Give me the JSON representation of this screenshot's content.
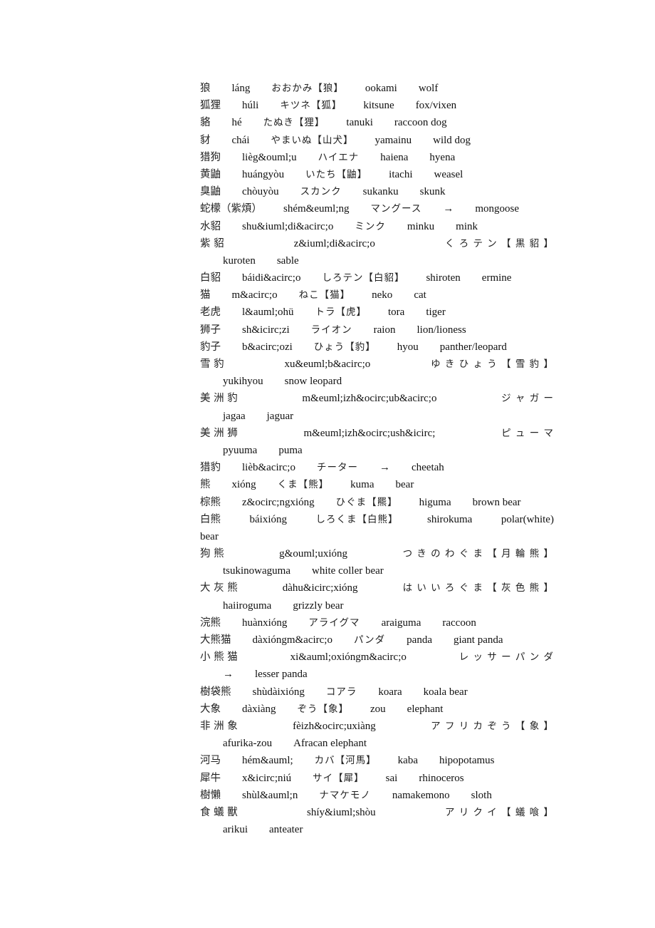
{
  "entries": [
    {
      "zh": "狼",
      "py": "láng",
      "ja": "おおかみ【狼】",
      "ro": "ookami",
      "en": "wolf"
    },
    {
      "zh": "狐狸",
      "py": "húli",
      "ja": "キツネ【狐】",
      "ro": "kitsune",
      "en": "fox/vixen"
    },
    {
      "zh": "貉",
      "py": "hé",
      "ja": "たぬき【狸】",
      "ro": "tanuki",
      "en": "raccoon dog"
    },
    {
      "zh": "豺",
      "py": "chái",
      "ja": "やまいぬ【山犬】",
      "ro": "yamainu",
      "en": "wild dog"
    },
    {
      "zh": "猎狗",
      "py": "lièg&ouml;u",
      "ja": "ハイエナ",
      "ro": "haiena",
      "en": "hyena"
    },
    {
      "zh": "黄鼬",
      "py": "huángyòu",
      "ja": "いたち【鼬】",
      "ro": "itachi",
      "en": "weasel"
    },
    {
      "zh": "臭鼬",
      "py": "chòuyòu",
      "ja": "スカンク",
      "ro": "sukanku",
      "en": "skunk"
    },
    {
      "zh": "蛇檬（紫煩）",
      "py": "shém&euml;ng",
      "ja": "マングース",
      "ro": "→",
      "en": "mongoose"
    },
    {
      "zh": "水貂",
      "py": "shu&iuml;di&acirc;o",
      "ja": "ミンク",
      "ro": "minku",
      "en": "mink"
    },
    {
      "zh": "紫 貂",
      "py": "z&iuml;di&acirc;o",
      "ja": "く ろ テ ン 【 黒 貂 】",
      "ro": "kuroten",
      "en": "sable",
      "wrap": true
    },
    {
      "zh": "白貂",
      "py": "báidi&acirc;o",
      "ja": "しろテン【白貂】",
      "ro": "shiroten",
      "en": "ermine"
    },
    {
      "zh": "猫",
      "py": "m&acirc;o",
      "ja": "ねこ【猫】",
      "ro": "neko",
      "en": "cat"
    },
    {
      "zh": "老虎",
      "py": "l&auml;ohü",
      "ja": "トラ【虎】",
      "ro": "tora",
      "en": "tiger"
    },
    {
      "zh": "狮子",
      "py": "sh&icirc;zi",
      "ja": "ライオン",
      "ro": "raion",
      "en": "lion/lioness"
    },
    {
      "zh": "豹子",
      "py": "b&acirc;ozi",
      "ja": "ひょう【豹】",
      "ro": "hyou",
      "en": "panther/leopard"
    },
    {
      "zh": "雪 豹",
      "py": "xu&euml;b&acirc;o",
      "ja": "ゆ き ひ ょ う 【 雪 豹 】",
      "ro": "yukihyou",
      "en": "snow leopard",
      "wrap": true
    },
    {
      "zh": "美 洲 豹",
      "py": "m&euml;izh&ocirc;ub&acirc;o",
      "ja": "ジ ャ ガ ー",
      "ro": "jagaa",
      "en": "jaguar",
      "wrap": true
    },
    {
      "zh": "美 洲 狮",
      "py": "m&euml;izh&ocirc;ush&icirc;",
      "ja": "ピ ュ ー マ",
      "ro": "pyuuma",
      "en": "puma",
      "wrap": true
    },
    {
      "zh": "猎豹",
      "py": "lièb&acirc;o",
      "ja": "チーター",
      "ro": "→",
      "en": "cheetah"
    },
    {
      "zh": "熊",
      "py": "xióng",
      "ja": "くま【熊】",
      "ro": "kuma",
      "en": "bear"
    },
    {
      "zh": "棕熊",
      "py": "z&ocirc;ngxióng",
      "ja": "ひぐま【羆】",
      "ro": "higuma",
      "en": "brown bear"
    },
    {
      "zh": "白熊",
      "py": "báixióng",
      "ja": "しろくま【白熊】",
      "ro": "shirokuma",
      "en": "polar(white)",
      "tail": "bear"
    },
    {
      "zh": "狗 熊",
      "py": "g&ouml;uxióng",
      "ja": "つ き の わ ぐ ま 【 月 輪 熊 】",
      "ro": "tsukinowaguma",
      "en": "white coller bear",
      "wrap": true
    },
    {
      "zh": "大 灰 熊",
      "py": "dàhu&icirc;xióng",
      "ja": "は い い ろ ぐ ま 【 灰 色 熊 】",
      "ro": "haiiroguma",
      "en": "grizzly bear",
      "wrap": true
    },
    {
      "zh": "浣熊",
      "py": "huànxióng",
      "ja": "アライグマ",
      "ro": "araiguma",
      "en": "raccoon"
    },
    {
      "zh": "大熊猫",
      "py": "dàxióngm&acirc;o",
      "ja": "パンダ",
      "ro": "panda",
      "en": "giant panda"
    },
    {
      "zh": "小 熊 猫",
      "py": "xi&auml;oxióngm&acirc;o",
      "ja": "レ ッ サ ー パ ン ダ",
      "ro": "→",
      "en": "lesser panda",
      "wrap": true
    },
    {
      "zh": "樹袋熊",
      "py": "shùdàixióng",
      "ja": "コアラ",
      "ro": "koara",
      "en": "koala bear"
    },
    {
      "zh": "大象",
      "py": "dàxiàng",
      "ja": "ぞう【象】",
      "ro": "zou",
      "en": "elephant"
    },
    {
      "zh": "非 洲 象",
      "py": "fèizh&ocirc;uxiàng",
      "ja": "ア フ リ カ ぞ う 【 象 】",
      "ro": "afurika-zou",
      "en": "Afracan elephant",
      "wrap": true
    },
    {
      "zh": "河马",
      "py": "hém&auml;",
      "ja": "カバ【河馬】",
      "ro": "kaba",
      "en": "hipopotamus"
    },
    {
      "zh": "犀牛",
      "py": "x&icirc;niú",
      "ja": "サイ【犀】",
      "ro": "sai",
      "en": "rhinoceros"
    },
    {
      "zh": "樹懶",
      "py": "shùl&auml;n",
      "ja": "ナマケモノ",
      "ro": "namakemono",
      "en": "sloth"
    },
    {
      "zh": "食 蟻 獸",
      "py": "shíy&iuml;shòu",
      "ja": "ア リ ク イ 【 蟻 喰 】",
      "ro": "arikui",
      "en": "anteater",
      "wrap": true
    }
  ]
}
